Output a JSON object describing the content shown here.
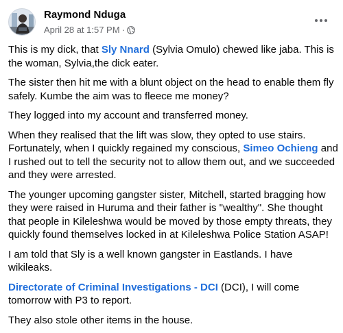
{
  "post": {
    "author": "Raymond Nduga",
    "timestamp": "April 28 at 1:57 PM",
    "separator": "·",
    "audience_icon": "globe-icon",
    "menu_icon": "more-options-icon",
    "paragraphs": [
      {
        "a": "This is my dick, that ",
        "link": "Sly Nnard",
        "b": " (Sylvia Omulo) chewed like jaba. This is the woman, Sylvia,the dick eater."
      },
      {
        "a": "The sister then hit me with a blunt object on the head to enable them fly safely. Kumbe the aim was to fleece me money?"
      },
      {
        "a": "They logged into my account and transferred money."
      },
      {
        "a": "When they realised that the lift was slow, they opted to use stairs. Fortunately, when I quickly regained my conscious, ",
        "link": "Simeo Ochieng",
        "b": " and I rushed out to tell the security not to allow them out, and we succeeded and they were arrested."
      },
      {
        "a": "The younger upcoming gangster sister, Mitchell, started bragging how they were raised in Huruma and their father is \"wealthy\". She thought that people in Kileleshwa would be moved by those empty threats, they quickly found themselves locked in at Kileleshwa Police Station ASAP!"
      },
      {
        "a": "I am told that Sly is a well known gangster in Eastlands. I have wikileaks."
      },
      {
        "a": "",
        "link": "Directorate of Criminal Investigations - DCI",
        "b": " (DCI), I will come tomorrow with P3 to report."
      },
      {
        "a": "They also stole other items in the house."
      }
    ]
  },
  "colors": {
    "link": "#216fdb",
    "meta": "#65676b",
    "text": "#050505"
  }
}
